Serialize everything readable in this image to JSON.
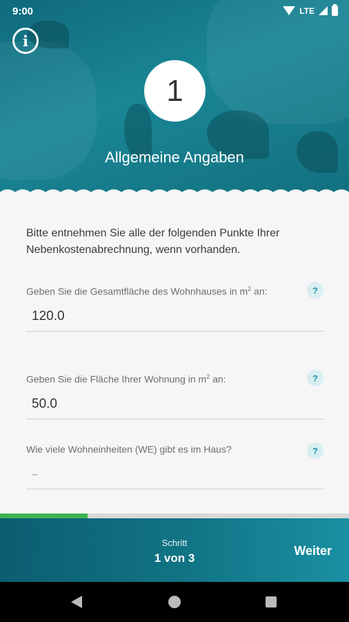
{
  "status_bar": {
    "time": "9:00",
    "network": "LTE"
  },
  "header": {
    "step_number": "1",
    "title": "Allgemeine Angaben"
  },
  "intro_text": "Bitte entnehmen Sie alle der folgenden Punkte Ihrer Nebenkostenabrechnung, wenn vorhanden.",
  "fields": [
    {
      "label_pre": "Geben Sie die Gesamtfläche des Wohnhauses in m",
      "label_sup": "2",
      "label_post": " an:",
      "value": "120.0",
      "placeholder": "",
      "help": "?"
    },
    {
      "label_pre": "Geben Sie die Fläche Ihrer Wohnung in m",
      "label_sup": "2",
      "label_post": " an:",
      "value": "50.0",
      "placeholder": "",
      "help": "?"
    },
    {
      "label_pre": "Wie viele Wohneinheiten (WE) gibt es im Haus?",
      "label_sup": "",
      "label_post": "",
      "value": "",
      "placeholder": "–",
      "help": "?"
    }
  ],
  "progress": {
    "fraction": 0.25
  },
  "footer": {
    "step_label": "Schritt",
    "step_counter": "1 von 3",
    "next_label": "Weiter"
  },
  "colors": {
    "header": "#1a8696",
    "accent": "#1a94a8",
    "progress_fill": "#3fb34f",
    "footer": "#117586"
  }
}
